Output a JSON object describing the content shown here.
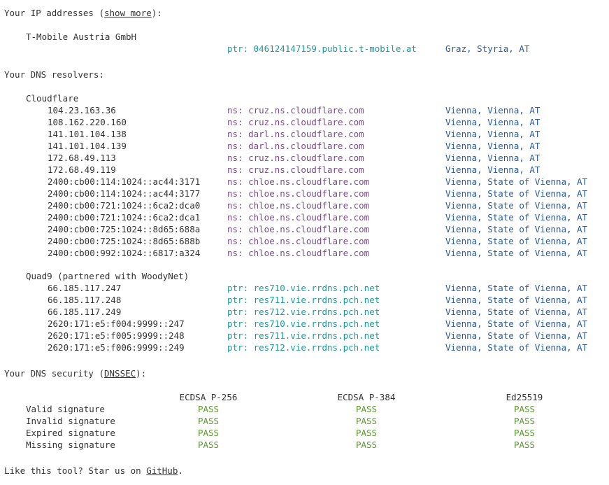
{
  "ip_section": {
    "heading_pre": "Your IP addresses (",
    "show_more": "show more",
    "heading_post": "):",
    "provider": "T-Mobile Austria GmbH",
    "ptr": "ptr: 046124147159.public.t-mobile.at",
    "location": "Graz, Styria, AT"
  },
  "dns_section": {
    "heading": "Your DNS resolvers:",
    "groups": [
      {
        "name": "Cloudflare",
        "rows": [
          {
            "ip": "104.23.163.36",
            "host": "ns: cruz.ns.cloudflare.com",
            "loc": "Vienna, Vienna, AT"
          },
          {
            "ip": "108.162.220.160",
            "host": "ns: cruz.ns.cloudflare.com",
            "loc": "Vienna, Vienna, AT"
          },
          {
            "ip": "141.101.104.138",
            "host": "ns: darl.ns.cloudflare.com",
            "loc": "Vienna, Vienna, AT"
          },
          {
            "ip": "141.101.104.139",
            "host": "ns: darl.ns.cloudflare.com",
            "loc": "Vienna, Vienna, AT"
          },
          {
            "ip": "172.68.49.113",
            "host": "ns: cruz.ns.cloudflare.com",
            "loc": "Vienna, Vienna, AT"
          },
          {
            "ip": "172.68.49.119",
            "host": "ns: cruz.ns.cloudflare.com",
            "loc": "Vienna, Vienna, AT"
          },
          {
            "ip": "2400:cb00:114:1024::ac44:3171",
            "host": "ns: chloe.ns.cloudflare.com",
            "loc": "Vienna, State of Vienna, AT"
          },
          {
            "ip": "2400:cb00:114:1024::ac44:3177",
            "host": "ns: chloe.ns.cloudflare.com",
            "loc": "Vienna, State of Vienna, AT"
          },
          {
            "ip": "2400:cb00:721:1024::6ca2:dca0",
            "host": "ns: chloe.ns.cloudflare.com",
            "loc": "Vienna, State of Vienna, AT"
          },
          {
            "ip": "2400:cb00:721:1024::6ca2:dca1",
            "host": "ns: chloe.ns.cloudflare.com",
            "loc": "Vienna, State of Vienna, AT"
          },
          {
            "ip": "2400:cb00:725:1024::8d65:688a",
            "host": "ns: chloe.ns.cloudflare.com",
            "loc": "Vienna, State of Vienna, AT"
          },
          {
            "ip": "2400:cb00:725:1024::8d65:688b",
            "host": "ns: chloe.ns.cloudflare.com",
            "loc": "Vienna, State of Vienna, AT"
          },
          {
            "ip": "2400:cb00:992:1024::6817:a324",
            "host": "ns: chloe.ns.cloudflare.com",
            "loc": "Vienna, State of Vienna, AT"
          }
        ]
      },
      {
        "name": "Quad9 (partnered with WoodyNet)",
        "rows": [
          {
            "ip": "66.185.117.247",
            "host": "ptr: res710.vie.rrdns.pch.net",
            "loc": "Vienna, State of Vienna, AT"
          },
          {
            "ip": "66.185.117.248",
            "host": "ptr: res711.vie.rrdns.pch.net",
            "loc": "Vienna, State of Vienna, AT"
          },
          {
            "ip": "66.185.117.249",
            "host": "ptr: res712.vie.rrdns.pch.net",
            "loc": "Vienna, State of Vienna, AT"
          },
          {
            "ip": "2620:171:e5:f004:9999::247",
            "host": "ptr: res710.vie.rrdns.pch.net",
            "loc": "Vienna, State of Vienna, AT"
          },
          {
            "ip": "2620:171:e5:f005:9999::248",
            "host": "ptr: res711.vie.rrdns.pch.net",
            "loc": "Vienna, State of Vienna, AT"
          },
          {
            "ip": "2620:171:e5:f006:9999::249",
            "host": "ptr: res712.vie.rrdns.pch.net",
            "loc": "Vienna, State of Vienna, AT"
          }
        ]
      }
    ]
  },
  "dnssec_section": {
    "heading_pre": "Your DNS security (",
    "dnssec_link": "DNSSEC",
    "heading_post": "):",
    "columns": [
      "ECDSA P-256",
      "ECDSA P-384",
      "Ed25519"
    ],
    "rows": [
      {
        "label": "Valid signature",
        "results": [
          "PASS",
          "PASS",
          "PASS"
        ]
      },
      {
        "label": "Invalid signature",
        "results": [
          "PASS",
          "PASS",
          "PASS"
        ]
      },
      {
        "label": "Expired signature",
        "results": [
          "PASS",
          "PASS",
          "PASS"
        ]
      },
      {
        "label": "Missing signature",
        "results": [
          "PASS",
          "PASS",
          "PASS"
        ]
      }
    ]
  },
  "footer": {
    "text_pre": "Like this tool? Star us on ",
    "github_link": "GitHub",
    "text_post": "."
  },
  "colors": {
    "text": "#333333",
    "ptr": "#1a9a9a",
    "ns": "#7a4a8a",
    "location": "#2a5a9a",
    "pass": "#5a9a2a"
  }
}
